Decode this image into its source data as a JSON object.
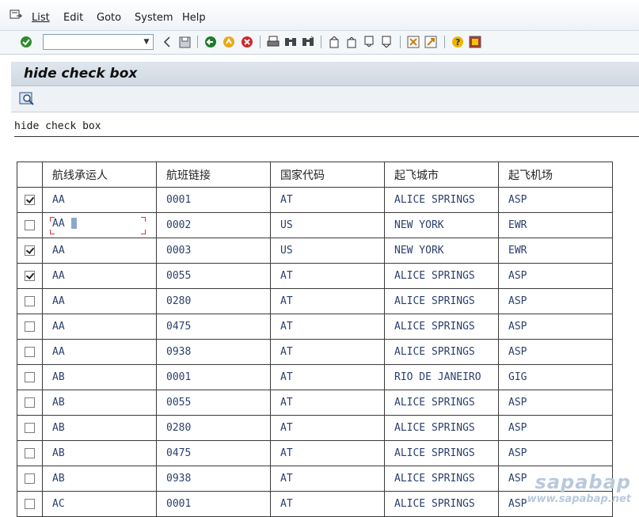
{
  "menubar": {
    "items": [
      "List",
      "Edit",
      "Goto",
      "System",
      "Help"
    ]
  },
  "toolbar": {
    "command_field_value": ""
  },
  "screen": {
    "title": "hide check box",
    "list_heading": "hide check box"
  },
  "table": {
    "headers": [
      "航线承运人",
      "航班链接",
      "国家代码",
      "起飞城市",
      "起飞机场"
    ],
    "rows": [
      {
        "checked": true,
        "cells": [
          "AA",
          "0001",
          "AT",
          "ALICE SPRINGS",
          "ASP"
        ]
      },
      {
        "checked": false,
        "cells": [
          "AA",
          "0002",
          "US",
          "NEW YORK",
          "EWR"
        ],
        "focused": true
      },
      {
        "checked": true,
        "cells": [
          "AA",
          "0003",
          "US",
          "NEW YORK",
          "EWR"
        ]
      },
      {
        "checked": true,
        "cells": [
          "AA",
          "0055",
          "AT",
          "ALICE SPRINGS",
          "ASP"
        ]
      },
      {
        "checked": false,
        "cells": [
          "AA",
          "0280",
          "AT",
          "ALICE SPRINGS",
          "ASP"
        ]
      },
      {
        "checked": false,
        "cells": [
          "AA",
          "0475",
          "AT",
          "ALICE SPRINGS",
          "ASP"
        ]
      },
      {
        "checked": false,
        "cells": [
          "AA",
          "0938",
          "AT",
          "ALICE SPRINGS",
          "ASP"
        ]
      },
      {
        "checked": false,
        "cells": [
          "AB",
          "0001",
          "AT",
          "RIO DE JANEIRO",
          "GIG"
        ]
      },
      {
        "checked": false,
        "cells": [
          "AB",
          "0055",
          "AT",
          "ALICE SPRINGS",
          "ASP"
        ]
      },
      {
        "checked": false,
        "cells": [
          "AB",
          "0280",
          "AT",
          "ALICE SPRINGS",
          "ASP"
        ]
      },
      {
        "checked": false,
        "cells": [
          "AB",
          "0475",
          "AT",
          "ALICE SPRINGS",
          "ASP"
        ]
      },
      {
        "checked": false,
        "cells": [
          "AB",
          "0938",
          "AT",
          "ALICE SPRINGS",
          "ASP"
        ]
      },
      {
        "checked": false,
        "cells": [
          "AC",
          "0001",
          "AT",
          "ALICE SPRINGS",
          "ASP"
        ]
      }
    ]
  },
  "watermark": {
    "brand": "sapabap",
    "url": "www.sapabap.net"
  },
  "colors": {
    "title_bar": "#d4dde7",
    "cell_text": "#2a3f6e",
    "focus_marker": "#dd3333"
  }
}
